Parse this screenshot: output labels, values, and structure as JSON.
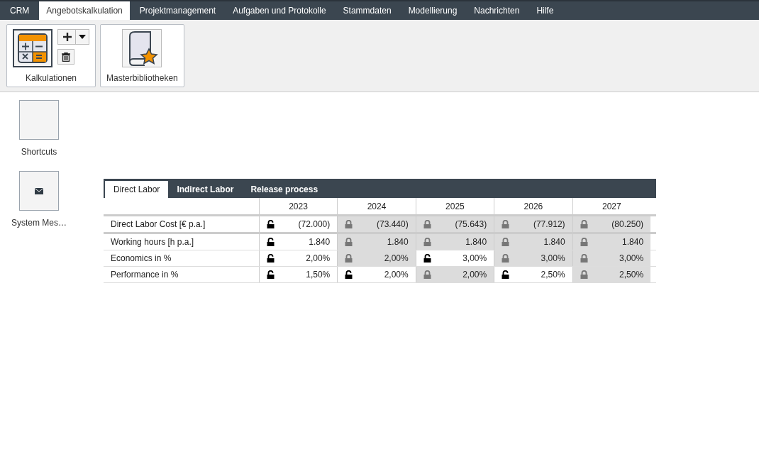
{
  "menu": [
    {
      "label": "CRM",
      "selected": false
    },
    {
      "label": "Angebotskalkulation",
      "selected": true
    },
    {
      "label": "Projektmanagement",
      "selected": false
    },
    {
      "label": "Aufgaben und Protokolle",
      "selected": false
    },
    {
      "label": "Stammdaten",
      "selected": false
    },
    {
      "label": "Modellierung",
      "selected": false
    },
    {
      "label": "Nachrichten",
      "selected": false
    },
    {
      "label": "Hilfe",
      "selected": false
    }
  ],
  "ribbon": [
    {
      "kind": "calculations",
      "label": "Kalkulationen"
    },
    {
      "kind": "library",
      "label": "Masterbibliotheken"
    }
  ],
  "sidebar": [
    {
      "kind": "blank",
      "label": "Shortcuts"
    },
    {
      "kind": "mail",
      "label": "System Mes…"
    }
  ],
  "tabs": [
    {
      "label": "Direct Labor",
      "selected": true
    },
    {
      "label": "Indirect Labor",
      "selected": false
    },
    {
      "label": "Release process",
      "selected": false
    }
  ],
  "years": [
    "2023",
    "2024",
    "2025",
    "2026",
    "2027"
  ],
  "row_groups": [
    [
      {
        "label": "Direct Labor Cost [€ p.a.]",
        "cells": [
          {
            "value": "(72.000)",
            "locked": false
          },
          {
            "value": "(73.440)",
            "locked": true
          },
          {
            "value": "(75.643)",
            "locked": true
          },
          {
            "value": "(77.912)",
            "locked": true
          },
          {
            "value": "(80.250)",
            "locked": true
          }
        ]
      }
    ],
    [
      {
        "label": "Working hours [h p.a.]",
        "cells": [
          {
            "value": "1.840",
            "locked": false
          },
          {
            "value": "1.840",
            "locked": true
          },
          {
            "value": "1.840",
            "locked": true
          },
          {
            "value": "1.840",
            "locked": true
          },
          {
            "value": "1.840",
            "locked": true
          }
        ]
      },
      {
        "label": "Economics in %",
        "cells": [
          {
            "value": "2,00%",
            "locked": false
          },
          {
            "value": "2,00%",
            "locked": true
          },
          {
            "value": "3,00%",
            "locked": false
          },
          {
            "value": "3,00%",
            "locked": true
          },
          {
            "value": "3,00%",
            "locked": true
          }
        ]
      },
      {
        "label": "Performance in %",
        "cells": [
          {
            "value": "1,50%",
            "locked": false
          },
          {
            "value": "2,00%",
            "locked": false
          },
          {
            "value": "2,00%",
            "locked": true
          },
          {
            "value": "2,50%",
            "locked": false
          },
          {
            "value": "2,50%",
            "locked": true
          }
        ]
      }
    ]
  ]
}
